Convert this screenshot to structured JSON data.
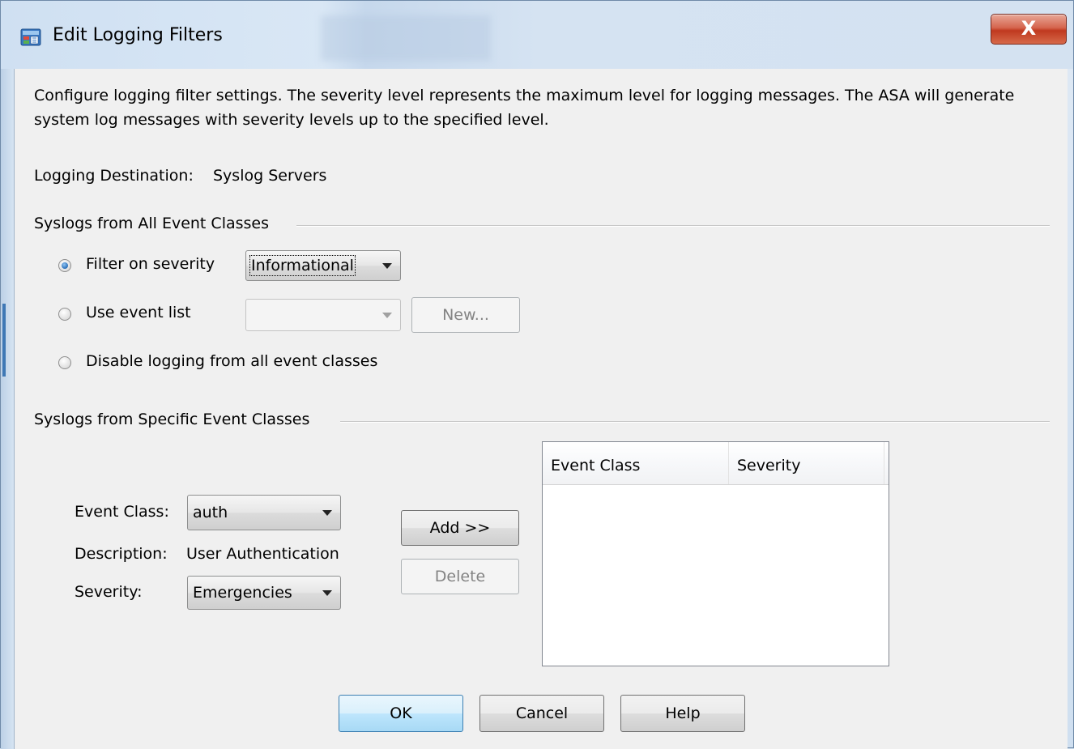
{
  "window": {
    "title": "Edit Logging Filters",
    "close_glyph": "X",
    "icon": "logging-filters-app-icon"
  },
  "intro_text": "Configure logging filter settings. The severity level represents the maximum level for logging messages. The ASA will generate system log messages with severity levels up to the specified level.",
  "destination": {
    "label": "Logging Destination:",
    "value": "Syslog Servers"
  },
  "all_events": {
    "group_title": "Syslogs from All Event Classes",
    "filter_on_severity_label": "Filter on severity",
    "filter_on_severity_checked": true,
    "severity_value": "Informational",
    "use_event_list_label": "Use event list",
    "event_list_value": "",
    "new_button": "New...",
    "disable_label": "Disable logging from all event classes"
  },
  "specific_events": {
    "group_title": "Syslogs from Specific Event Classes",
    "event_class_label": "Event Class:",
    "event_class_value": "auth",
    "description_label": "Description:",
    "description_value": "User Authentication",
    "severity_label": "Severity:",
    "severity_value": "Emergencies",
    "add_button": "Add >>",
    "delete_button": "Delete",
    "table": {
      "columns": [
        "Event Class",
        "Severity"
      ],
      "rows": []
    }
  },
  "footer": {
    "ok": "OK",
    "cancel": "Cancel",
    "help": "Help"
  }
}
